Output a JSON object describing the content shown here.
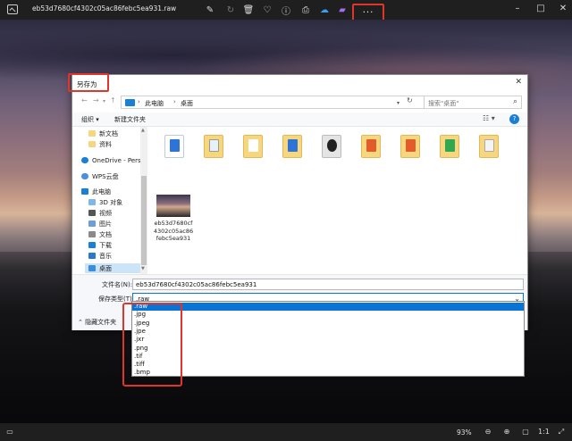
{
  "app": {
    "title": "eb53d7680cf4302c05ac86febc5ea931.raw",
    "more_label": "···",
    "window_minimize": "–",
    "window_maximize": "□",
    "window_close": "✕",
    "zoom": "93%"
  },
  "dialog": {
    "title": "另存为",
    "breadcrumb": [
      "此电脑",
      "桌面"
    ],
    "search_placeholder": "搜索\"桌面\"",
    "organize_label": "组织 ▾",
    "new_folder_label": "新建文件夹",
    "nav_items": [
      {
        "label": "新文档",
        "icon": "folder"
      },
      {
        "label": "资料",
        "icon": "folder"
      },
      {
        "label": "OneDrive - Perso",
        "icon": "cloud"
      },
      {
        "label": "WPS云盘",
        "icon": "cloud"
      },
      {
        "label": "此电脑",
        "icon": "pc"
      },
      {
        "label": "3D 对象",
        "icon": "cube"
      },
      {
        "label": "视频",
        "icon": "video"
      },
      {
        "label": "图片",
        "icon": "image"
      },
      {
        "label": "文档",
        "icon": "doc"
      },
      {
        "label": "下载",
        "icon": "download"
      },
      {
        "label": "音乐",
        "icon": "music"
      },
      {
        "label": "桌面",
        "icon": "desktop"
      }
    ],
    "file_item_caption": "eb53d7680cf4302c05ac86febc5ea931",
    "filename_label": "文件名(N):",
    "filename_value": "eb53d7680cf4302c05ac86febc5ea931",
    "filetype_label": "保存类型(T):",
    "filetype_value": ".raw",
    "hide_folders_label": "隐藏文件夹",
    "filetype_options": [
      ".raw",
      ".jpg",
      ".jpeg",
      ".jpe",
      ".jxr",
      ".png",
      ".tif",
      ".tiff",
      ".bmp"
    ]
  },
  "colors": {
    "highlight": "#e0352b",
    "accent": "#0a74d6"
  }
}
